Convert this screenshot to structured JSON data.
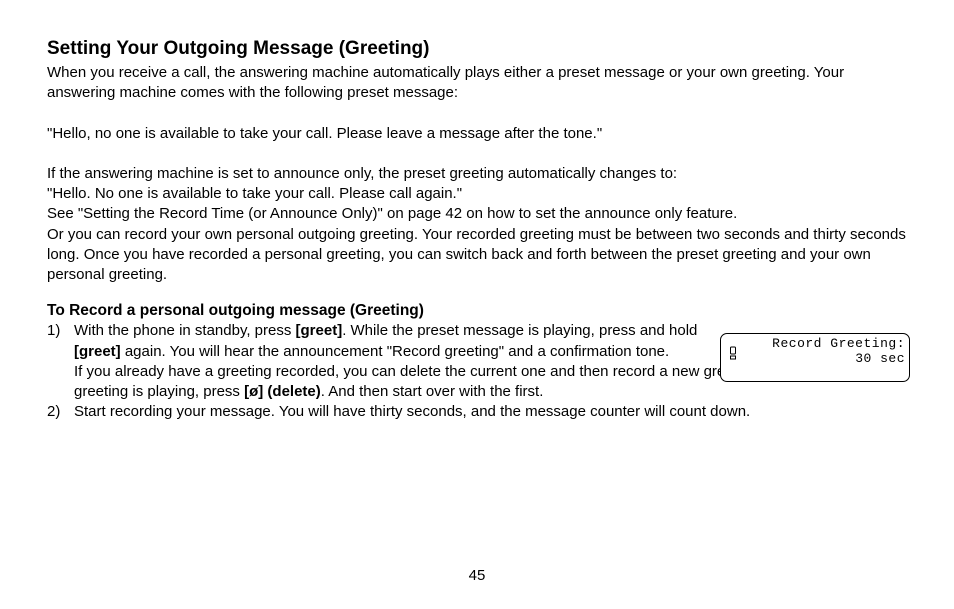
{
  "heading": "Setting Your Outgoing Message (Greeting)",
  "p1": "When you receive a call, the answering machine automatically plays either a preset message or your own greeting. Your answering machine comes with the following preset message:",
  "p2": "\"Hello, no one is available to take your call. Please leave a message after the tone.\"",
  "p3a": "If the answering machine is set to announce only, the preset greeting automatically changes to:",
  "p3b": "\"Hello. No one is available to take your call. Please call again.\"",
  "p3c": "See \"Setting the Record Time (or Announce Only)\" on page 42 on how to set the announce only feature.",
  "p3d": "Or you can record your own personal outgoing greeting. Your recorded greeting must be between two seconds and thirty seconds long. Once you have recorded a personal greeting, you can switch back and forth between the preset greeting and your own personal greeting.",
  "subheading": "To Record a personal outgoing message (Greeting)",
  "step1": {
    "num": "1)",
    "a": "With the phone in standby, press ",
    "b_bold": "[greet]",
    "c": ". While the preset message is playing, press and hold ",
    "d_bold": "[greet]",
    "e": " again. You will hear the announcement \"Record greeting\" and a confirmation tone.",
    "f": "If you already have a greeting recorded, you can delete the current one and then record a new greeting. While the current greeting is playing, press ",
    "g_bold": "[ø] (delete)",
    "h": ". And then start over with the first."
  },
  "step2": {
    "num": "2)",
    "text": "Start recording your message. You will have thirty seconds, and the message counter will count down."
  },
  "lcd": {
    "line1": "Record Greeting:",
    "line2": "30 sec",
    "icon": "␣"
  },
  "page": "45"
}
